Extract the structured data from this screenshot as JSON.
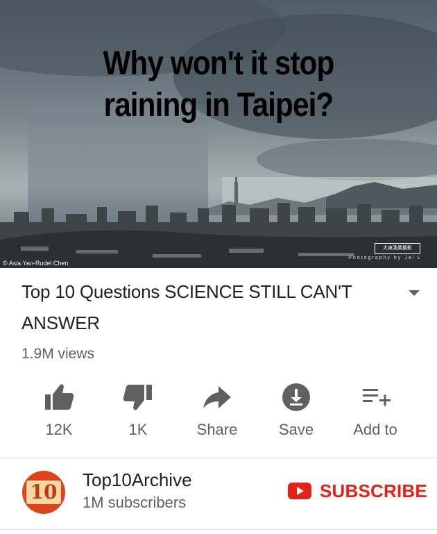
{
  "thumbnail": {
    "overlay_line1": "Why won't it stop",
    "overlay_line2": "raining in Taipei?",
    "credit_left": "© Asia Yan-Rudel Chen",
    "credit_right": "Photography by Jai L",
    "logo_text": "大東漁業攝影"
  },
  "video": {
    "title": "Top 10 Questions SCIENCE STILL CAN'T ANSWER",
    "views": "1.9M views"
  },
  "actions": {
    "like": "12K",
    "dislike": "1K",
    "share": "Share",
    "save": "Save",
    "add_to": "Add to"
  },
  "channel": {
    "name": "Top10Archive",
    "subscribers": "1M subscribers",
    "avatar_text": "10"
  },
  "subscribe": {
    "label": "SUBSCRIBE"
  },
  "colors": {
    "accent_red": "#e62117",
    "secondary_text": "#606060",
    "primary_text": "#212121"
  }
}
